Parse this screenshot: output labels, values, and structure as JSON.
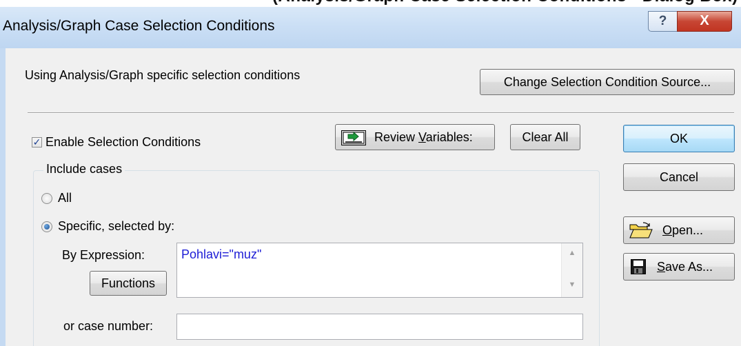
{
  "top_strip_text": "(Analysis/Graph Case Selection Conditions - Dialog Box)",
  "window": {
    "title": "Analysis/Graph Case Selection Conditions",
    "help_glyph": "?",
    "close_glyph": "X"
  },
  "source_label": "Using Analysis/Graph specific selection conditions",
  "change_source_button": "Change Selection Condition Source...",
  "enable_checkbox": {
    "label": "Enable Selection Conditions",
    "checked": true
  },
  "review_variables_button": {
    "prefix": "Review ",
    "accel": "V",
    "suffix": "ariables:"
  },
  "clear_all_button": "Clear All",
  "ok_button": "OK",
  "cancel_button": "Cancel",
  "open_button": {
    "accel": "O",
    "suffix": "pen..."
  },
  "save_as_button": {
    "accel": "S",
    "suffix": "ave As..."
  },
  "include_cases": {
    "title": "Include cases",
    "options": [
      {
        "label": "All",
        "selected": false
      },
      {
        "label": "Specific, selected by:",
        "selected": true
      }
    ],
    "by_expression_label": "By Expression:",
    "expression_value": "Pohlavi=\"muz\"",
    "functions_button": "Functions",
    "case_number_label": "or case number:",
    "case_number_value": ""
  },
  "colors": {
    "titlebar": "#cbdff5",
    "dialog_bg": "#f0f0f0",
    "expression_text": "#1d1dd6",
    "close_button": "#c74634"
  }
}
